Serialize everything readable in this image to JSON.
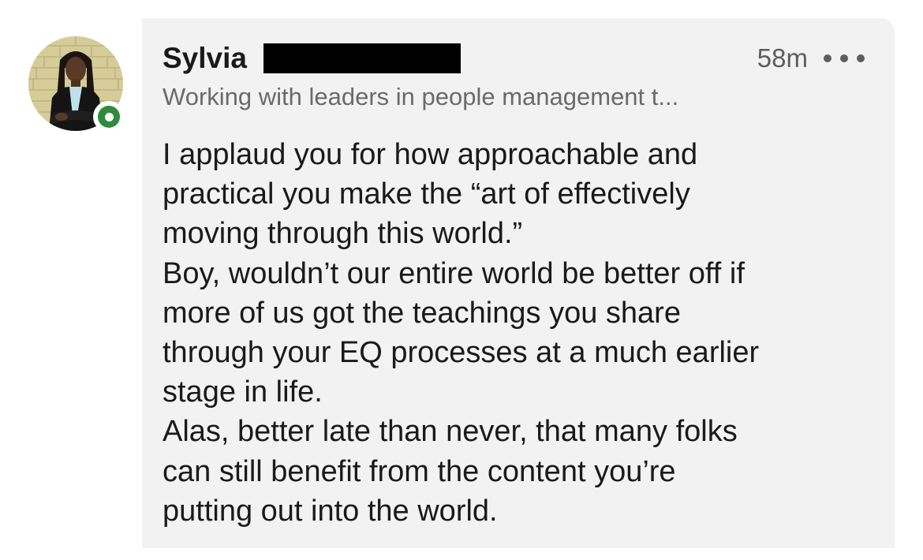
{
  "author": {
    "name": "Sylvia",
    "headline": "Working with leaders in people management t...",
    "online_status_color": "#2f8a3c"
  },
  "meta": {
    "timestamp": "58m",
    "more_icon": "more-horizontal-icon"
  },
  "comment": {
    "lines": [
      "I applaud you for how approachable and",
      "practical you make the “art of effectively",
      "moving through this world.”",
      "Boy, wouldn’t our entire world be better off if",
      "more of us got the teachings you share",
      "through your EQ processes at a much earlier",
      "stage in life.",
      "Alas, better late than never, that many folks",
      "can still benefit from the content you’re",
      "putting out into the world."
    ]
  },
  "colors": {
    "bubble_background": "#f2f2f2",
    "redaction": "#000000"
  }
}
